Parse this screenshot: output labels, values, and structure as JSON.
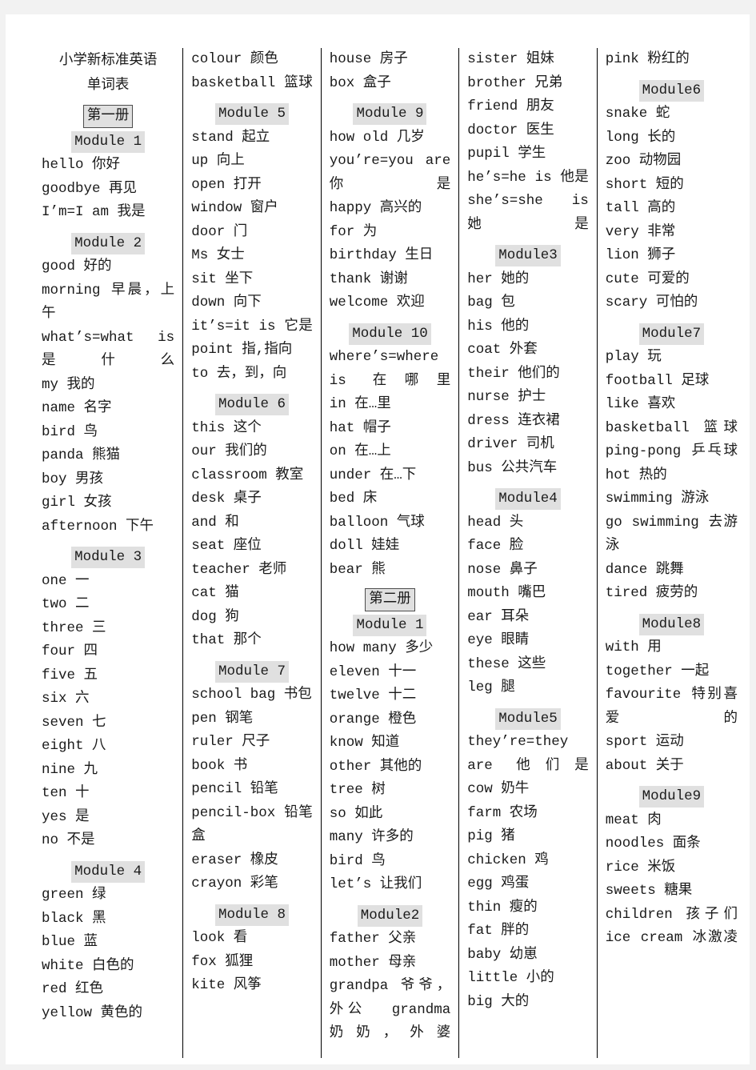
{
  "title": "小学新标准英语\n单词表",
  "books": {
    "book1": "第一册",
    "book2": "第二册"
  },
  "columns": [
    {
      "id": "col-1",
      "blocks": [
        {
          "type": "title",
          "text": "小学新标准英语\n单词表"
        },
        {
          "type": "book",
          "text": "第一册"
        },
        {
          "type": "module",
          "text": "Module 1"
        },
        {
          "type": "entry",
          "text": "hello 你好"
        },
        {
          "type": "entry",
          "text": "goodbye 再见"
        },
        {
          "type": "entry",
          "text": "I’m=I am 我是"
        },
        {
          "type": "module",
          "text": "Module 2"
        },
        {
          "type": "entry",
          "text": "good 好的"
        },
        {
          "type": "entry",
          "text": "morning 早晨，上午"
        },
        {
          "type": "entry",
          "text": "what’s=what is 是什么"
        },
        {
          "type": "entry",
          "text": "my 我的"
        },
        {
          "type": "entry",
          "text": "name 名字"
        },
        {
          "type": "entry",
          "text": "bird 鸟"
        },
        {
          "type": "entry",
          "text": "panda 熊猫"
        },
        {
          "type": "entry",
          "text": "boy 男孩"
        },
        {
          "type": "entry",
          "text": "girl 女孩"
        },
        {
          "type": "entry",
          "text": "afternoon 下午"
        },
        {
          "type": "module",
          "text": "Module 3"
        },
        {
          "type": "entry",
          "text": "one 一"
        },
        {
          "type": "entry",
          "text": "two 二"
        },
        {
          "type": "entry",
          "text": "three 三"
        },
        {
          "type": "entry",
          "text": "four 四"
        },
        {
          "type": "entry",
          "text": "five 五"
        },
        {
          "type": "entry",
          "text": "six 六"
        },
        {
          "type": "entry",
          "text": "seven 七"
        },
        {
          "type": "entry",
          "text": "eight 八"
        },
        {
          "type": "entry",
          "text": "nine 九"
        },
        {
          "type": "entry",
          "text": "ten 十"
        },
        {
          "type": "entry",
          "text": "yes 是"
        },
        {
          "type": "entry",
          "text": "no 不是"
        },
        {
          "type": "module",
          "text": "Module 4"
        },
        {
          "type": "entry",
          "text": "green 绿"
        },
        {
          "type": "entry",
          "text": "black 黑"
        },
        {
          "type": "entry",
          "text": "blue 蓝"
        },
        {
          "type": "entry",
          "text": "white 白色的"
        },
        {
          "type": "entry",
          "text": "red 红色"
        },
        {
          "type": "entry",
          "text": "yellow 黄色的"
        }
      ]
    },
    {
      "id": "col-2",
      "blocks": [
        {
          "type": "entry",
          "text": "colour 颜色"
        },
        {
          "type": "entry",
          "text": "basketball 篮球"
        },
        {
          "type": "module",
          "text": "Module 5"
        },
        {
          "type": "entry",
          "text": "stand 起立"
        },
        {
          "type": "entry",
          "text": "up 向上"
        },
        {
          "type": "entry",
          "text": "open 打开"
        },
        {
          "type": "entry",
          "text": "window 窗户"
        },
        {
          "type": "entry",
          "text": "door 门"
        },
        {
          "type": "entry",
          "text": "Ms 女士"
        },
        {
          "type": "entry",
          "text": "sit 坐下"
        },
        {
          "type": "entry",
          "text": "down 向下"
        },
        {
          "type": "entry",
          "text": "it’s=it is 它是"
        },
        {
          "type": "entry",
          "text": "point 指,指向"
        },
        {
          "type": "entry",
          "text": "to 去，到，向"
        },
        {
          "type": "module",
          "text": "Module 6"
        },
        {
          "type": "entry",
          "text": "this 这个"
        },
        {
          "type": "entry",
          "text": "our 我们的"
        },
        {
          "type": "entry",
          "text": "classroom 教室"
        },
        {
          "type": "entry",
          "text": "desk 桌子"
        },
        {
          "type": "entry",
          "text": "and 和"
        },
        {
          "type": "entry",
          "text": "seat 座位"
        },
        {
          "type": "entry",
          "text": "teacher 老师"
        },
        {
          "type": "entry",
          "text": "cat 猫"
        },
        {
          "type": "entry",
          "text": "dog 狗"
        },
        {
          "type": "entry",
          "text": "that 那个"
        },
        {
          "type": "module",
          "text": "Module 7"
        },
        {
          "type": "entry",
          "text": "school bag 书包"
        },
        {
          "type": "entry",
          "text": "pen 钢笔"
        },
        {
          "type": "entry",
          "text": "ruler 尺子"
        },
        {
          "type": "entry",
          "text": "book 书"
        },
        {
          "type": "entry",
          "text": "pencil 铅笔"
        },
        {
          "type": "entry",
          "text": "pencil-box 铅笔盒"
        },
        {
          "type": "entry",
          "text": "eraser 橡皮"
        },
        {
          "type": "entry",
          "text": "crayon 彩笔"
        },
        {
          "type": "module",
          "text": "Module 8"
        },
        {
          "type": "entry",
          "text": "look 看"
        },
        {
          "type": "entry",
          "text": "fox 狐狸"
        },
        {
          "type": "entry",
          "text": "kite 风筝"
        }
      ]
    },
    {
      "id": "col-3",
      "blocks": [
        {
          "type": "entry",
          "text": "house 房子"
        },
        {
          "type": "entry",
          "text": "box 盒子"
        },
        {
          "type": "module",
          "text": "Module 9"
        },
        {
          "type": "entry",
          "text": "how old 几岁"
        },
        {
          "type": "entry",
          "text": "you’re=you are 你是"
        },
        {
          "type": "entry",
          "text": "happy 高兴的"
        },
        {
          "type": "entry",
          "text": "for 为"
        },
        {
          "type": "entry",
          "text": "birthday 生日"
        },
        {
          "type": "entry",
          "text": "thank 谢谢"
        },
        {
          "type": "entry",
          "text": "welcome 欢迎"
        },
        {
          "type": "module",
          "text": "Module 10"
        },
        {
          "type": "entry",
          "text": "where’s=where is 在哪里"
        },
        {
          "type": "entry",
          "text": "in 在…里"
        },
        {
          "type": "entry",
          "text": "hat 帽子"
        },
        {
          "type": "entry",
          "text": "on 在…上"
        },
        {
          "type": "entry",
          "text": "under 在…下"
        },
        {
          "type": "entry",
          "text": "bed 床"
        },
        {
          "type": "entry",
          "text": "balloon 气球"
        },
        {
          "type": "entry",
          "text": "doll 娃娃"
        },
        {
          "type": "entry",
          "text": "bear 熊"
        },
        {
          "type": "book",
          "text": "第二册"
        },
        {
          "type": "module",
          "text": "Module 1"
        },
        {
          "type": "entry",
          "text": "how many 多少"
        },
        {
          "type": "entry",
          "text": "eleven 十一"
        },
        {
          "type": "entry",
          "text": "twelve 十二"
        },
        {
          "type": "entry",
          "text": "orange 橙色"
        },
        {
          "type": "entry",
          "text": "know 知道"
        },
        {
          "type": "entry",
          "text": "other 其他的"
        },
        {
          "type": "entry",
          "text": "tree 树"
        },
        {
          "type": "entry",
          "text": "so 如此"
        },
        {
          "type": "entry",
          "text": "many 许多的"
        },
        {
          "type": "entry",
          "text": "bird 鸟"
        },
        {
          "type": "entry",
          "text": "let’s 让我们"
        },
        {
          "type": "module",
          "text": "Module2"
        },
        {
          "type": "entry",
          "text": "father 父亲"
        },
        {
          "type": "entry",
          "text": "mother 母亲"
        },
        {
          "type": "entry",
          "text": "grandpa 爷爷，外公  grandma 奶奶，外婆"
        }
      ]
    },
    {
      "id": "col-4",
      "blocks": [
        {
          "type": "entry",
          "text": "sister 姐妹"
        },
        {
          "type": "entry",
          "text": "brother 兄弟"
        },
        {
          "type": "entry",
          "text": "friend 朋友"
        },
        {
          "type": "entry",
          "text": "doctor 医生"
        },
        {
          "type": "entry",
          "text": "pupil 学生"
        },
        {
          "type": "entry",
          "text": "he’s=he is 他是"
        },
        {
          "type": "entry",
          "text": "she’s=she is 她是"
        },
        {
          "type": "module",
          "text": "Module3"
        },
        {
          "type": "entry",
          "text": "her 她的"
        },
        {
          "type": "entry",
          "text": "bag 包"
        },
        {
          "type": "entry",
          "text": "his 他的"
        },
        {
          "type": "entry",
          "text": "coat 外套"
        },
        {
          "type": "entry",
          "text": "their 他们的"
        },
        {
          "type": "entry",
          "text": "nurse 护士"
        },
        {
          "type": "entry",
          "text": "dress 连衣裙"
        },
        {
          "type": "entry",
          "text": "driver 司机"
        },
        {
          "type": "entry",
          "text": "bus 公共汽车"
        },
        {
          "type": "module",
          "text": "Module4"
        },
        {
          "type": "entry",
          "text": "head 头"
        },
        {
          "type": "entry",
          "text": "face 脸"
        },
        {
          "type": "entry",
          "text": "nose 鼻子"
        },
        {
          "type": "entry",
          "text": "mouth 嘴巴"
        },
        {
          "type": "entry",
          "text": "ear 耳朵"
        },
        {
          "type": "entry",
          "text": "eye 眼睛"
        },
        {
          "type": "entry",
          "text": "these 这些"
        },
        {
          "type": "entry",
          "text": "leg 腿"
        },
        {
          "type": "module",
          "text": "Module5"
        },
        {
          "type": "entry",
          "text": "they’re=they are 他们是"
        },
        {
          "type": "entry",
          "text": "cow 奶牛"
        },
        {
          "type": "entry",
          "text": "farm 农场"
        },
        {
          "type": "entry",
          "text": "pig 猪"
        },
        {
          "type": "entry",
          "text": "chicken 鸡"
        },
        {
          "type": "entry",
          "text": "egg 鸡蛋"
        },
        {
          "type": "entry",
          "text": "thin 瘦的"
        },
        {
          "type": "entry",
          "text": "fat 胖的"
        },
        {
          "type": "entry",
          "text": "baby 幼崽"
        },
        {
          "type": "entry",
          "text": "little 小的"
        },
        {
          "type": "entry",
          "text": "big 大的"
        }
      ]
    },
    {
      "id": "col-5",
      "blocks": [
        {
          "type": "entry",
          "text": "pink 粉红的"
        },
        {
          "type": "module",
          "text": "Module6"
        },
        {
          "type": "entry",
          "text": "snake 蛇"
        },
        {
          "type": "entry",
          "text": "long 长的"
        },
        {
          "type": "entry",
          "text": "zoo 动物园"
        },
        {
          "type": "entry",
          "text": "short 短的"
        },
        {
          "type": "entry",
          "text": "tall 高的"
        },
        {
          "type": "entry",
          "text": "very 非常"
        },
        {
          "type": "entry",
          "text": "lion 狮子"
        },
        {
          "type": "entry",
          "text": "cute 可爱的"
        },
        {
          "type": "entry",
          "text": "scary 可怕的"
        },
        {
          "type": "module",
          "text": "Module7"
        },
        {
          "type": "entry",
          "text": "play 玩"
        },
        {
          "type": "entry",
          "text": "football 足球"
        },
        {
          "type": "entry",
          "text": "like 喜欢"
        },
        {
          "type": "entry",
          "text": "basketball 篮球"
        },
        {
          "type": "entry",
          "text": "ping-pong 乒乓球"
        },
        {
          "type": "entry",
          "text": "hot 热的"
        },
        {
          "type": "entry",
          "text": "swimming 游泳"
        },
        {
          "type": "entry",
          "text": "go swimming 去游泳"
        },
        {
          "type": "entry",
          "text": "dance 跳舞"
        },
        {
          "type": "entry",
          "text": "tired 疲劳的"
        },
        {
          "type": "module",
          "text": "Module8"
        },
        {
          "type": "entry",
          "text": "with 用"
        },
        {
          "type": "entry",
          "text": "together 一起"
        },
        {
          "type": "entry",
          "text": "favourite 特别喜爱的"
        },
        {
          "type": "entry",
          "text": "sport 运动"
        },
        {
          "type": "entry",
          "text": "about 关于"
        },
        {
          "type": "module",
          "text": "Module9"
        },
        {
          "type": "entry",
          "text": "meat 肉"
        },
        {
          "type": "entry",
          "text": "noodles 面条"
        },
        {
          "type": "entry",
          "text": "rice 米饭"
        },
        {
          "type": "entry",
          "text": "sweets 糖果"
        },
        {
          "type": "entry",
          "text": "children 孩子们"
        },
        {
          "type": "entry",
          "text": "ice cream 冰激凌"
        }
      ]
    }
  ]
}
